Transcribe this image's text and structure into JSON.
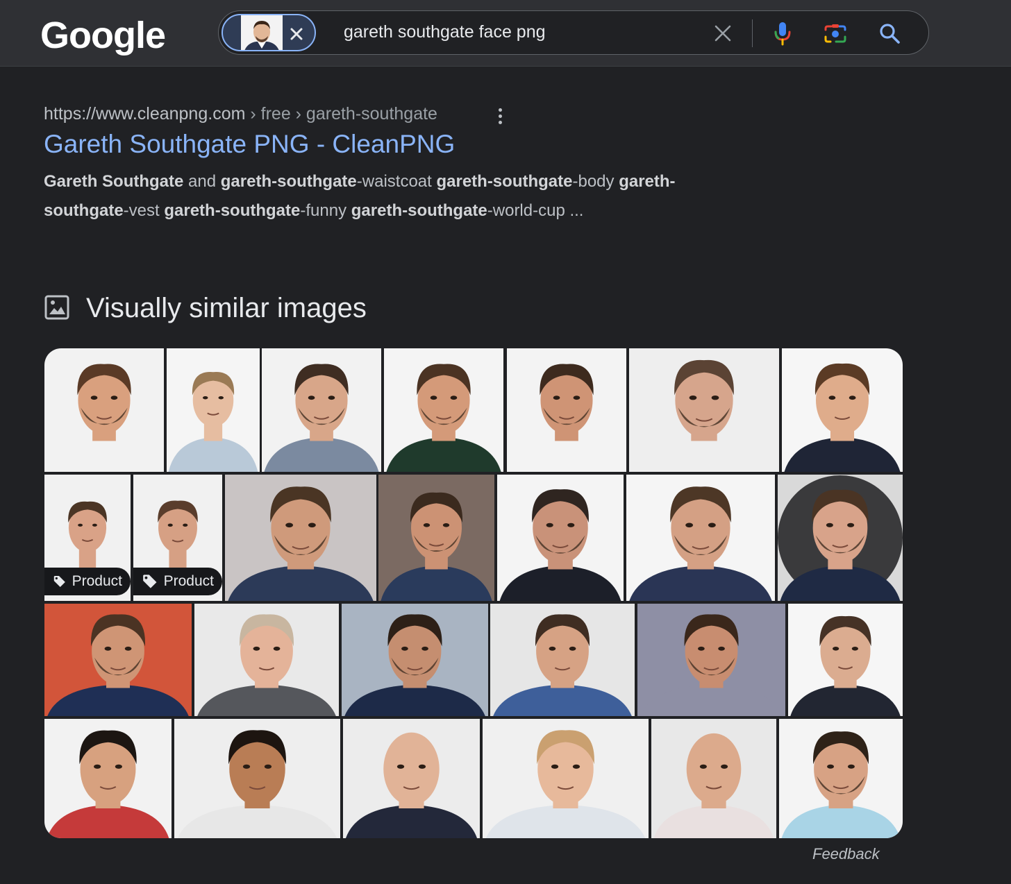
{
  "header": {
    "logo": "Google",
    "search_query": "gareth southgate face png",
    "icons": [
      "close-icon",
      "clear-icon",
      "mic-icon",
      "lens-camera-icon",
      "search-icon"
    ]
  },
  "result": {
    "url_domain": "https://www.cleanpng.com",
    "url_path": " › free › gareth-southgate",
    "title": "Gareth Southgate PNG - CleanPNG",
    "snippet": [
      {
        "t": "Gareth Southgate",
        "b": true
      },
      {
        "t": " and ",
        "b": false
      },
      {
        "t": "gareth-southgate",
        "b": true
      },
      {
        "t": "-waistcoat ",
        "b": false
      },
      {
        "t": "gareth-southgate",
        "b": true
      },
      {
        "t": "-body ",
        "b": false
      },
      {
        "t": "gareth-southgate",
        "b": true
      },
      {
        "t": "-vest ",
        "b": false
      },
      {
        "t": "gareth-southgate",
        "b": true
      },
      {
        "t": "-funny ",
        "b": false
      },
      {
        "t": "gareth-southgate",
        "b": true
      },
      {
        "t": "-world-cup ...",
        "b": false
      }
    ]
  },
  "section": {
    "title": "Visually similar images"
  },
  "tags": {
    "product_label": "Product"
  },
  "footer": {
    "feedback": "Feedback"
  },
  "colors": {
    "page_bg": "#202124",
    "header_bg": "#2f3034",
    "link_blue": "#8ab4f8",
    "text": "#e8eaed",
    "muted": "#bdc1c6"
  }
}
